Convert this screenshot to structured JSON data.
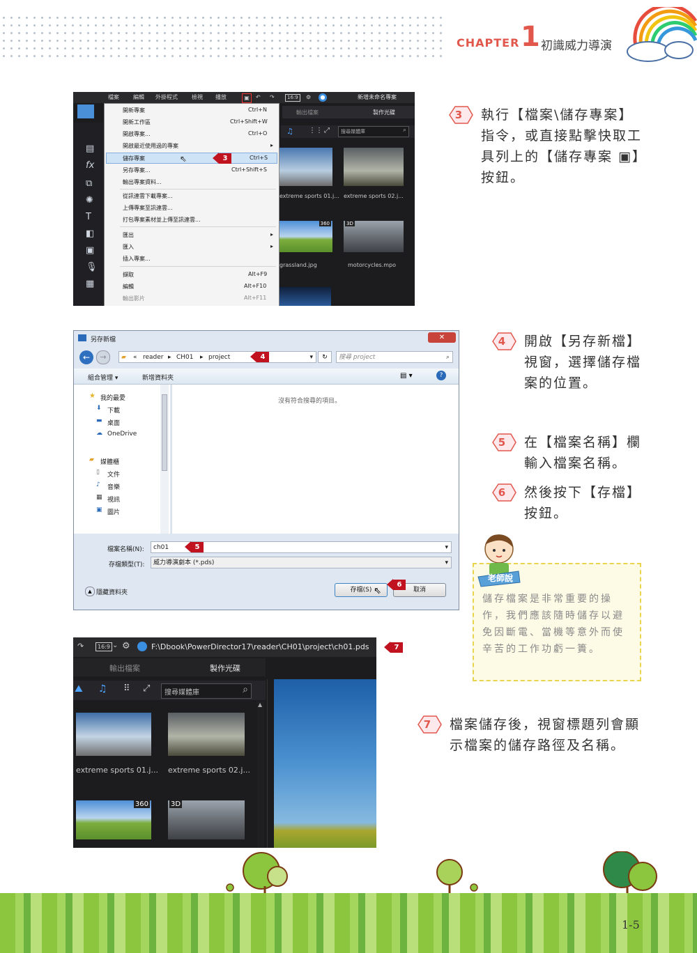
{
  "header": {
    "chapter_word": "CHAPTER",
    "chapter_number": "1",
    "chapter_title": "初識威力導演"
  },
  "shot1": {
    "menubar": [
      "檔案",
      "編輯",
      "外掛程式",
      "檢視",
      "播放"
    ],
    "project_name": "新增未命名專案",
    "tab_output": "輸出檔案",
    "tab_disc": "製作光碟",
    "search_placeholder": "搜尋媒體庫",
    "menu_items": [
      {
        "label": "開新專案",
        "shortcut": "Ctrl+N"
      },
      {
        "label": "開新工作區",
        "shortcut": "Ctrl+Shift+W"
      },
      {
        "label": "開啟專案...",
        "shortcut": "Ctrl+O"
      },
      {
        "label": "開啟最近使用過的專案",
        "shortcut": "▸"
      },
      {
        "label": "儲存專案",
        "shortcut": "Ctrl+S"
      },
      {
        "label": "另存專案...",
        "shortcut": "Ctrl+Shift+S"
      },
      {
        "label": "輸出專案資料...",
        "shortcut": ""
      },
      {
        "label": "從訊連雲下載專案...",
        "shortcut": ""
      },
      {
        "label": "上傳專案至訊連雲...",
        "shortcut": ""
      },
      {
        "label": "打包專案素材並上傳至訊連雲...",
        "shortcut": ""
      },
      {
        "label": "匯出",
        "shortcut": "▸"
      },
      {
        "label": "匯入",
        "shortcut": "▸"
      },
      {
        "label": "插入專案...",
        "shortcut": ""
      },
      {
        "label": "擷取",
        "shortcut": "Alt+F9"
      },
      {
        "label": "編輯",
        "shortcut": "Alt+F10"
      },
      {
        "label": "輸出影片",
        "shortcut": "Alt+F11"
      }
    ],
    "thumbs": [
      "extreme sports 01.j...",
      "extreme sports 02.j...",
      "grassland.jpg",
      "motorcycles.mpo"
    ],
    "badge_360": "360",
    "badge_3d": "3D",
    "marker": "3"
  },
  "step3": {
    "num": "3",
    "text": "執行【檔案\\儲存專案】指令，或直接點擊快取工具列上的【儲存專案 ▣】按鈕。"
  },
  "dialog": {
    "title": "另存新檔",
    "path": [
      "«",
      "reader",
      "▸",
      "CH01",
      "▸",
      "project"
    ],
    "search_placeholder": "搜尋 project",
    "organize": "組合管理 ▾",
    "new_folder": "新增資料夾",
    "empty_msg": "沒有符合搜尋的項目。",
    "nav": [
      "我的最愛",
      "下載",
      "桌面",
      "OneDrive",
      "媒體櫃",
      "文件",
      "音樂",
      "視訊",
      "圖片"
    ],
    "filename_label": "檔案名稱(N):",
    "filename_value": "ch01",
    "filetype_label": "存檔類型(T):",
    "filetype_value": "威力導演劇本 (*.pds)",
    "hide_folders": "隱藏資料夾",
    "save_btn": "存檔(S)",
    "cancel_btn": "取消",
    "marker4": "4",
    "marker5": "5",
    "marker6": "6"
  },
  "step4": {
    "num": "4",
    "text": "開啟【另存新檔】視窗，選擇儲存檔案的位置。"
  },
  "step5": {
    "num": "5",
    "text": "在【檔案名稱】欄輸入檔案名稱。"
  },
  "step6": {
    "num": "6",
    "text": "然後按下【存檔】按鈕。"
  },
  "teacher_note": {
    "label": "老師說",
    "text": "儲存檔案是非常重要的操作，我們應該隨時儲存以避免因斷電、當機等意外而使辛苦的工作功虧一簣。"
  },
  "shot3": {
    "aspect": "16:9",
    "path": "F:\\Dbook\\PowerDirector17\\reader\\CH01\\project\\ch01.pds",
    "tab_output": "輸出檔案",
    "tab_disc": "製作光碟",
    "search_placeholder": "搜尋媒體庫",
    "thumbs": [
      "extreme sports 01.j...",
      "extreme sports 02.j..."
    ],
    "badge_360": "360",
    "badge_3d": "3D",
    "marker": "7"
  },
  "step7": {
    "num": "7",
    "text": "檔案儲存後，視窗標題列會顯示檔案的儲存路徑及名稱。"
  },
  "footer": {
    "page_number": "1-5"
  },
  "colors": {
    "accent": "#e2574c",
    "marker": "#c1121f",
    "note_border": "#e8d44d"
  }
}
